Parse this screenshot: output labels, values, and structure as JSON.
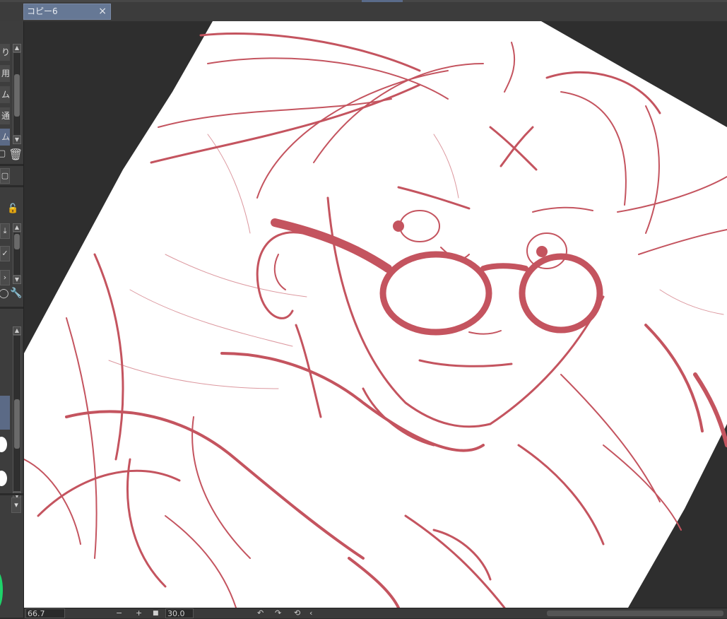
{
  "tab": {
    "title": "コピー6",
    "close": "×"
  },
  "left_panel": {
    "items": [
      "り",
      "用",
      "ム",
      "通",
      "ム"
    ],
    "selected_index": 4,
    "icons": [
      "trash-icon",
      "lock-icon",
      "download-icon",
      "check-icon",
      "chevron-right-icon",
      "wrench-icon"
    ]
  },
  "status": {
    "zoom": "66.7",
    "minus": "−",
    "plus": "+",
    "angle": "30.0",
    "rotate_left": "↶",
    "rotate_right": "↷",
    "reset": "⟲",
    "prev": "‹"
  }
}
